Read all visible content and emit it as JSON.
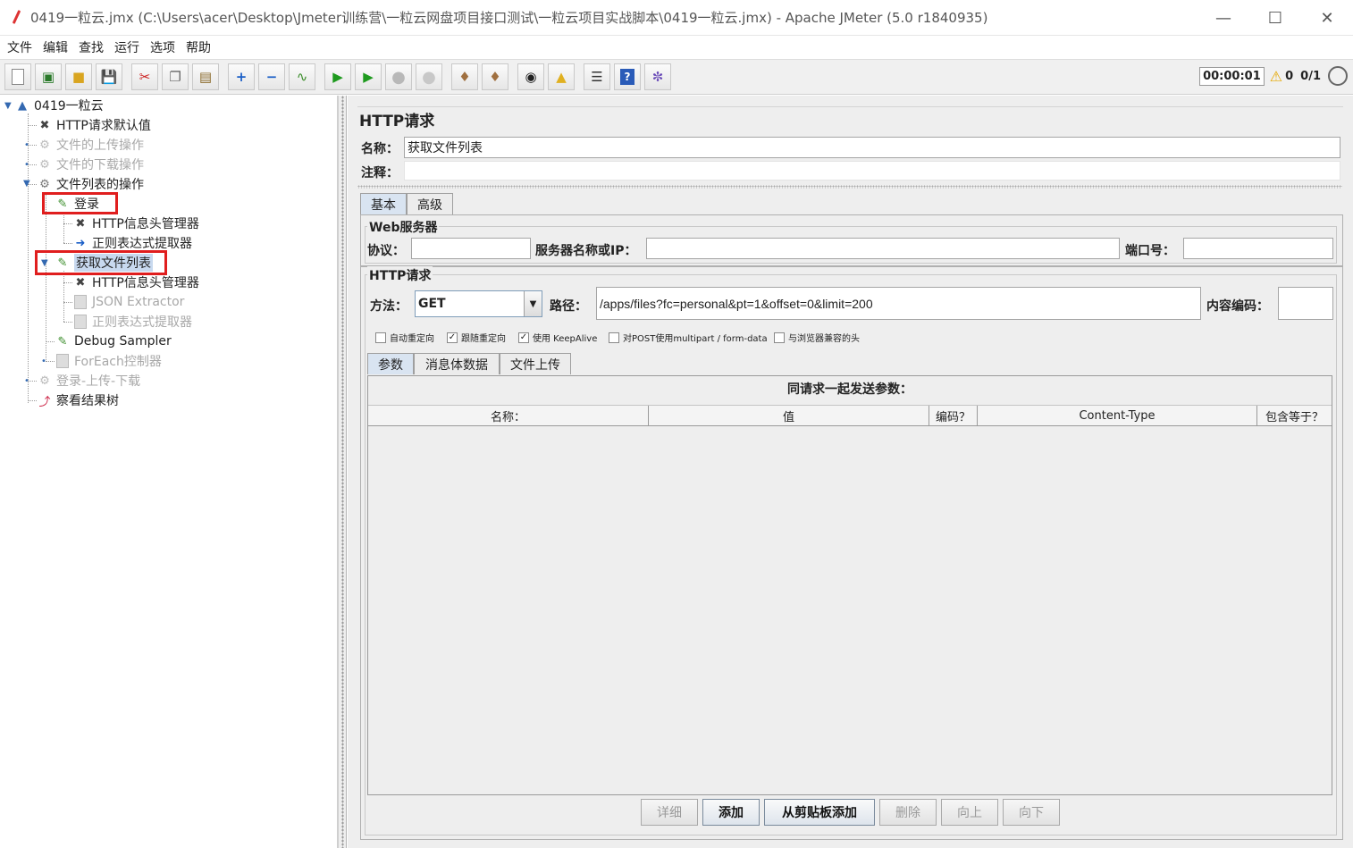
{
  "window": {
    "title": "0419一粒云.jmx (C:\\Users\\acer\\Desktop\\Jmeter训练营\\一粒云网盘项目接口测试\\一粒云项目实战脚本\\0419一粒云.jmx) - Apache JMeter (5.0 r1840935)",
    "minimize_icon": "minimize-icon",
    "maximize_icon": "maximize-icon",
    "close_icon": "close-icon"
  },
  "menu": [
    "文件",
    "编辑",
    "查找",
    "运行",
    "选项",
    "帮助"
  ],
  "toolbar": {
    "timer": "00:00:01",
    "warnings": "0",
    "threads": "0/1"
  },
  "tree": {
    "root": "0419一粒云",
    "items": [
      {
        "label": "HTTP请求默认值"
      },
      {
        "label": "文件的上传操作"
      },
      {
        "label": "文件的下载操作"
      },
      {
        "label": "文件列表的操作"
      },
      {
        "label": "登录"
      },
      {
        "label": "HTTP信息头管理器"
      },
      {
        "label": "正则表达式提取器"
      },
      {
        "label": "获取文件列表"
      },
      {
        "label": "HTTP信息头管理器"
      },
      {
        "label": "JSON Extractor"
      },
      {
        "label": "正则表达式提取器"
      },
      {
        "label": "Debug Sampler"
      },
      {
        "label": "ForEach控制器"
      },
      {
        "label": "登录-上传-下载"
      },
      {
        "label": "察看结果树"
      }
    ]
  },
  "panel": {
    "title": "HTTP请求",
    "name_label": "名称：",
    "name_value": "获取文件列表",
    "comment_label": "注释：",
    "comment_value": "",
    "tabs": [
      "基本",
      "高级"
    ],
    "web_server": {
      "group_label": "Web服务器",
      "protocol_label": "协议：",
      "protocol_value": "",
      "server_label": "服务器名称或IP：",
      "server_value": "",
      "port_label": "端口号：",
      "port_value": ""
    },
    "http_request": {
      "group_label": "HTTP请求",
      "method_label": "方法：",
      "method_value": "GET",
      "path_label": "路径：",
      "path_value": "/apps/files?fc=personal&pt=1&offset=0&limit=200",
      "encoding_label": "内容编码：",
      "encoding_value": ""
    },
    "checkboxes": [
      {
        "label": "自动重定向",
        "checked": false
      },
      {
        "label": "跟随重定向",
        "checked": true
      },
      {
        "label": "使用 KeepAlive",
        "checked": true
      },
      {
        "label": "对POST使用multipart / form-data",
        "checked": false
      },
      {
        "label": "与浏览器兼容的头",
        "checked": false
      }
    ],
    "param_tabs": [
      "参数",
      "消息体数据",
      "文件上传"
    ],
    "params_caption": "同请求一起发送参数：",
    "columns": [
      "名称：",
      "值",
      "编码？",
      "Content-Type",
      "包含等于？"
    ],
    "rows": [],
    "buttons": {
      "detail": "详细",
      "add": "添加",
      "add_clipboard": "从剪贴板添加",
      "delete": "删除",
      "up": "向上",
      "down": "向下"
    }
  }
}
